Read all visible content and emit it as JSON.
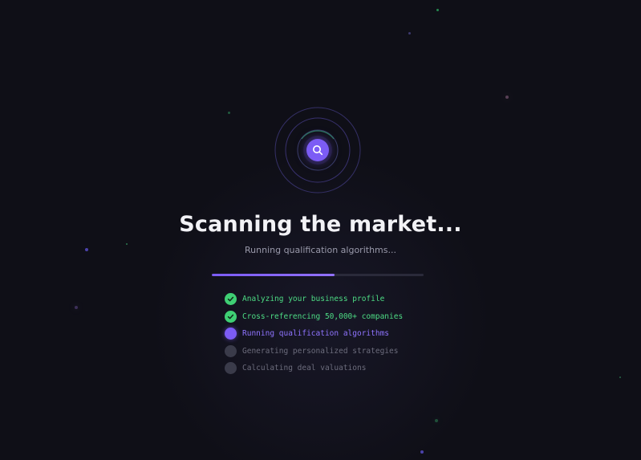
{
  "header": {
    "title": "Scanning the market...",
    "subtitle": "Running qualification algorithms..."
  },
  "progress": {
    "percent": 58
  },
  "icons": {
    "center": "search-icon",
    "done": "check-icon"
  },
  "colors": {
    "accent": "#7c5cf5",
    "done": "#3fcf74",
    "pending": "#3a3b4a",
    "background": "#0f0f17"
  },
  "steps": [
    {
      "label": "Analyzing your business profile",
      "status": "done"
    },
    {
      "label": "Cross-referencing 50,000+ companies",
      "status": "done"
    },
    {
      "label": "Running qualification algorithms",
      "status": "active"
    },
    {
      "label": "Generating personalized strategies",
      "status": "pending"
    },
    {
      "label": "Calculating deal valuations",
      "status": "pending"
    }
  ]
}
